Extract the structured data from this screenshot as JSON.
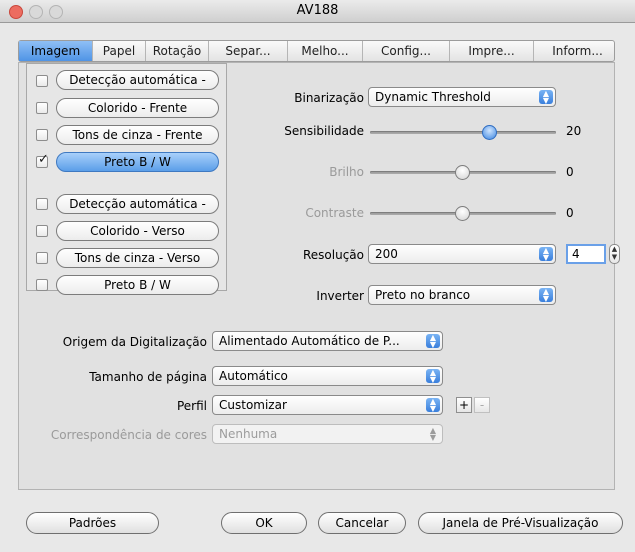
{
  "window": {
    "title": "AV188"
  },
  "tabs": [
    "Imagem",
    "Papel",
    "Rotação",
    "Separ...",
    "Melho...",
    "Config...",
    "Impre...",
    "Inform..."
  ],
  "image_types": [
    {
      "label": "Detecção automática -",
      "checked": false
    },
    {
      "label": "Colorido - Frente",
      "checked": false
    },
    {
      "label": "Tons de cinza - Frente",
      "checked": false
    },
    {
      "label": "Preto B / W",
      "checked": true
    },
    {
      "label": "Detecção automática -",
      "checked": false
    },
    {
      "label": "Colorido - Verso",
      "checked": false
    },
    {
      "label": "Tons de cinza - Verso",
      "checked": false
    },
    {
      "label": "Preto B / W",
      "checked": false
    }
  ],
  "settings": {
    "binarizacao_label": "Binarização",
    "binarizacao_value": "Dynamic Threshold",
    "sensibilidade_label": "Sensibilidade",
    "sensibilidade_value": "20",
    "brilho_label": "Brilho",
    "brilho_value": "0",
    "contraste_label": "Contraste",
    "contraste_value": "0",
    "resolucao_label": "Resolução",
    "resolucao_value": "200",
    "resolucao_field": "4",
    "inverter_label": "Inverter",
    "inverter_value": "Preto no branco"
  },
  "source": {
    "origem_label": "Origem da Digitalização",
    "origem_value": "Alimentado Automático de P...",
    "tamanho_label": "Tamanho de página",
    "tamanho_value": "Automático",
    "perfil_label": "Perfil",
    "perfil_value": "Customizar",
    "perfil_add": "+",
    "perfil_remove": "-",
    "cores_label": "Correspondência de cores",
    "cores_value": "Nenhuma"
  },
  "buttons": {
    "padroes": "Padrões",
    "ok": "OK",
    "cancelar": "Cancelar",
    "preview": "Janela de Pré-Visualização"
  },
  "icons": {
    "check": "✓",
    "popup_arrows": "▲▼",
    "stepper": "▲▼"
  }
}
